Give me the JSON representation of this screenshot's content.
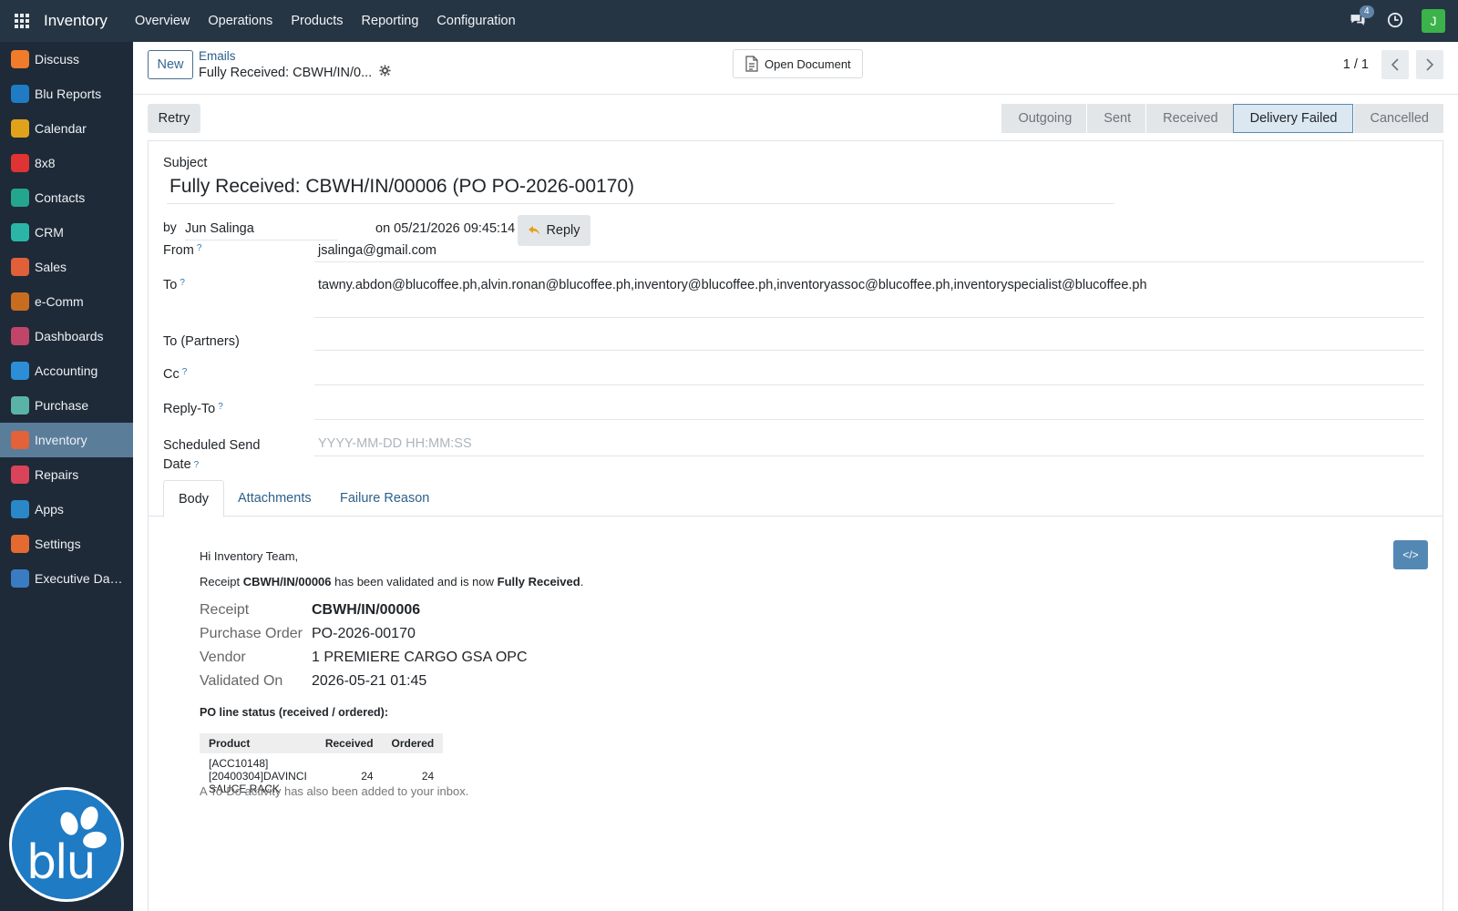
{
  "topbar": {
    "brand": "Inventory",
    "menu": [
      "Overview",
      "Operations",
      "Products",
      "Reporting",
      "Configuration"
    ],
    "chat_count": "4",
    "user_initial": "J"
  },
  "sidebar": {
    "items": [
      {
        "label": "Discuss",
        "icon": "discuss-icon",
        "color": "#f07b2a"
      },
      {
        "label": "Blu Reports",
        "icon": "blu-reports-icon",
        "color": "#1f7bc4"
      },
      {
        "label": "Calendar",
        "icon": "calendar-icon",
        "color": "#e0a21b"
      },
      {
        "label": "8x8",
        "icon": "8x8-icon",
        "color": "#e03333"
      },
      {
        "label": "Contacts",
        "icon": "contacts-icon",
        "color": "#24a58e"
      },
      {
        "label": "CRM",
        "icon": "crm-icon",
        "color": "#2bb5a6"
      },
      {
        "label": "Sales",
        "icon": "sales-icon",
        "color": "#e0603a"
      },
      {
        "label": "e-Comm",
        "icon": "ecomm-icon",
        "color": "#c86d1f"
      },
      {
        "label": "Dashboards",
        "icon": "dashboards-icon",
        "color": "#c0456a"
      },
      {
        "label": "Accounting",
        "icon": "accounting-icon",
        "color": "#2d8ed8"
      },
      {
        "label": "Purchase",
        "icon": "purchase-icon",
        "color": "#5bb3a8"
      },
      {
        "label": "Inventory",
        "icon": "inventory-icon",
        "color": "#e3623a"
      },
      {
        "label": "Repairs",
        "icon": "repairs-icon",
        "color": "#d9445a"
      },
      {
        "label": "Apps",
        "icon": "apps-icon",
        "color": "#2b88c8"
      },
      {
        "label": "Settings",
        "icon": "settings-icon",
        "color": "#e46a30"
      },
      {
        "label": "Executive Das...",
        "icon": "executive-dashboard-icon",
        "color": "#3a7cc2"
      }
    ],
    "active": "Inventory",
    "logo_text": "blu"
  },
  "control": {
    "new_label": "New",
    "breadcrumb_parent": "Emails",
    "breadcrumb_current": "Fully Received: CBWH/IN/0...",
    "open_document_label": "Open Document",
    "pager_value": "1 / 1"
  },
  "status": {
    "retry_label": "Retry",
    "stages": [
      "Outgoing",
      "Sent",
      "Received",
      "Delivery Failed",
      "Cancelled"
    ],
    "current": "Delivery Failed"
  },
  "form": {
    "subject_label": "Subject",
    "subject_value": "Fully Received: CBWH/IN/00006 (PO PO-2026-00170)",
    "by_label": "by",
    "author": "Jun Salinga",
    "date_text": "on 05/21/2026 09:45:14",
    "reply_label": "Reply",
    "from_label": "From",
    "from_value": "jsalinga@gmail.com",
    "to_label": "To",
    "to_value": "tawny.abdon@blucoffee.ph,alvin.ronan@blucoffee.ph,inventory@blucoffee.ph,inventoryassoc@blucoffee.ph,inventoryspecialist@blucoffee.ph",
    "to_partners_label": "To (Partners)",
    "cc_label": "Cc",
    "reply_to_label": "Reply-To",
    "scheduled_label_1": "Scheduled Send",
    "scheduled_label_2": "Date",
    "scheduled_placeholder": "YYYY-MM-DD HH:MM:SS",
    "help_mark": "?"
  },
  "tabs": [
    "Body",
    "Attachments",
    "Failure Reason"
  ],
  "active_tab": "Body",
  "code_button_label": "</>",
  "email": {
    "greeting": "Hi Inventory Team,",
    "line_prefix": "Receipt ",
    "line_receipt": "CBWH/IN/00006",
    "line_middle": " has been validated and is now ",
    "line_status": "Fully Received",
    "line_end": ".",
    "details": [
      {
        "key": "Receipt",
        "value": "CBWH/IN/00006"
      },
      {
        "key": "Purchase Order",
        "value": "PO-2026-00170"
      },
      {
        "key": "Vendor",
        "value": "1 PREMIERE CARGO GSA OPC"
      },
      {
        "key": "Validated On",
        "value": "2026-05-21 01:45"
      }
    ],
    "table_title": "PO line status (received / ordered):",
    "table_headers": [
      "Product",
      "Received",
      "Ordered"
    ],
    "table_rows": [
      [
        "[ACC10148][20400304]DAVINCI SAUCE RACK",
        "24",
        "24"
      ]
    ],
    "note": "A To-Do activity has also been added to your inbox."
  }
}
